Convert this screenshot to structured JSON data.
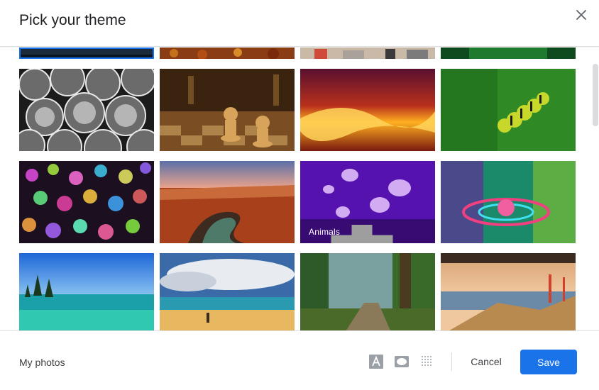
{
  "dialog": {
    "title": "Pick your theme",
    "close_icon": "close-icon"
  },
  "themes": {
    "top_row": [
      {
        "name": "dark-blue-theme",
        "selected": true
      },
      {
        "name": "autumn-leaves-theme",
        "selected": false
      },
      {
        "name": "city-street-theme",
        "selected": false
      },
      {
        "name": "green-grass-theme",
        "selected": false
      }
    ],
    "rows": [
      [
        "metal-pipes-theme",
        "chess-theme",
        "canyon-glow-theme",
        "caterpillar-theme"
      ],
      [
        "bokeh-lights-theme",
        "red-canyon-theme",
        "jellyfish-theme",
        "water-drop-theme"
      ],
      [
        "lake-tahoe-theme",
        "beach-theme",
        "forest-theme",
        "golden-gate-theme"
      ]
    ],
    "hovered": {
      "label": "Animals",
      "delete_icon": "trash-icon"
    }
  },
  "footer": {
    "my_photos": "My photos",
    "text_color_icon": "text-color-icon",
    "readable_background_icon": "readable-background-icon",
    "vignette_icon": "vignette-icon",
    "cancel_label": "Cancel",
    "save_label": "Save",
    "accent": "#1a73e8"
  }
}
